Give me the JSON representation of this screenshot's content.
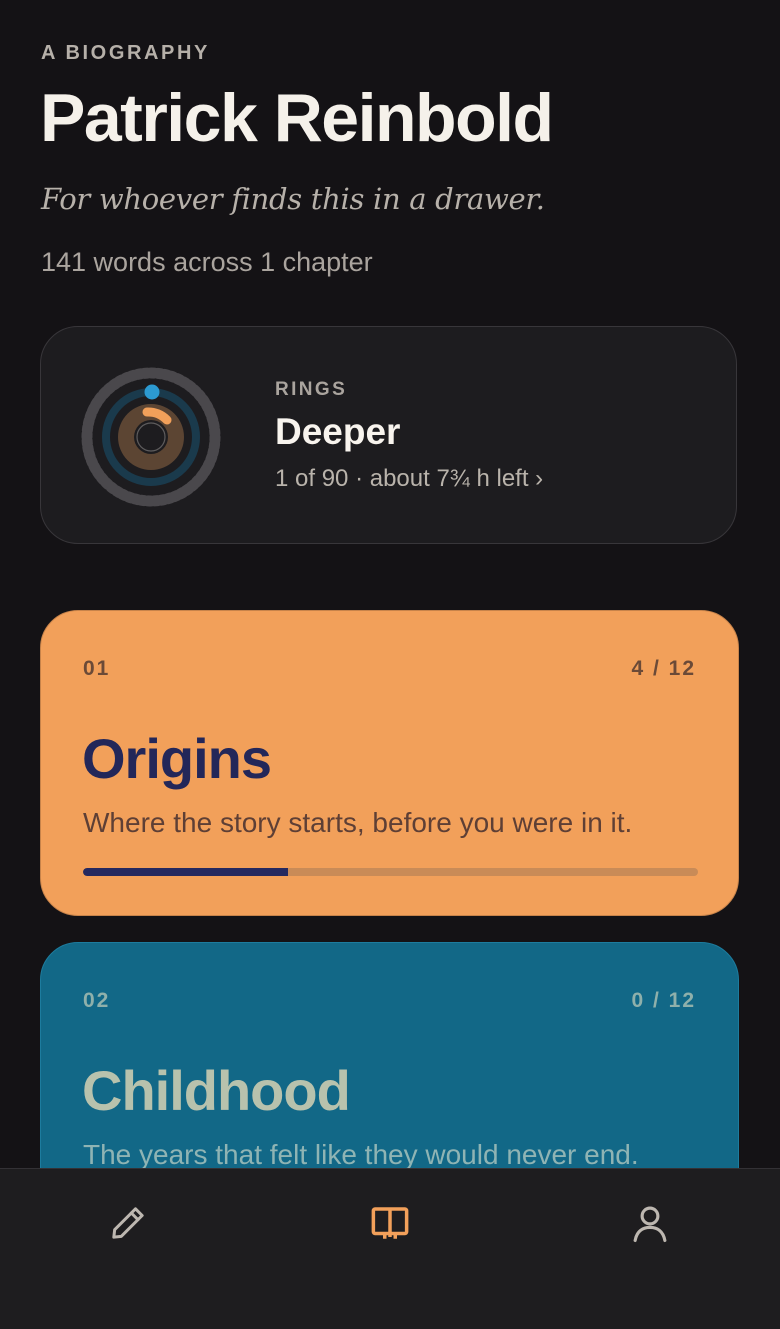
{
  "header": {
    "kicker": "A BIOGRAPHY",
    "title": "Patrick Reinbold",
    "subtitle": "For whoever finds this in a drawer.",
    "meta": "141 words across 1 chapter"
  },
  "rings": {
    "label": "RINGS",
    "level": "Deeper",
    "progress": "1 of 90 · about 7¾ h left ›",
    "completed": 1,
    "total": 90
  },
  "chapters": [
    {
      "number": "01",
      "count": "4 / 12",
      "title": "Origins",
      "description": "Where the story starts, before you were in it.",
      "answered": 4,
      "total": 12,
      "color": "#f2a05a"
    },
    {
      "number": "02",
      "count": "0 / 12",
      "title": "Childhood",
      "description": "The years that felt like they would never end.",
      "answered": 0,
      "total": 12,
      "color": "#126887"
    }
  ],
  "nav": {
    "items": [
      {
        "icon": "pencil-icon"
      },
      {
        "icon": "book-icon",
        "active": true
      },
      {
        "icon": "person-icon"
      }
    ],
    "active_color": "#f2a05a",
    "inactive_color": "#bdb7b0"
  }
}
